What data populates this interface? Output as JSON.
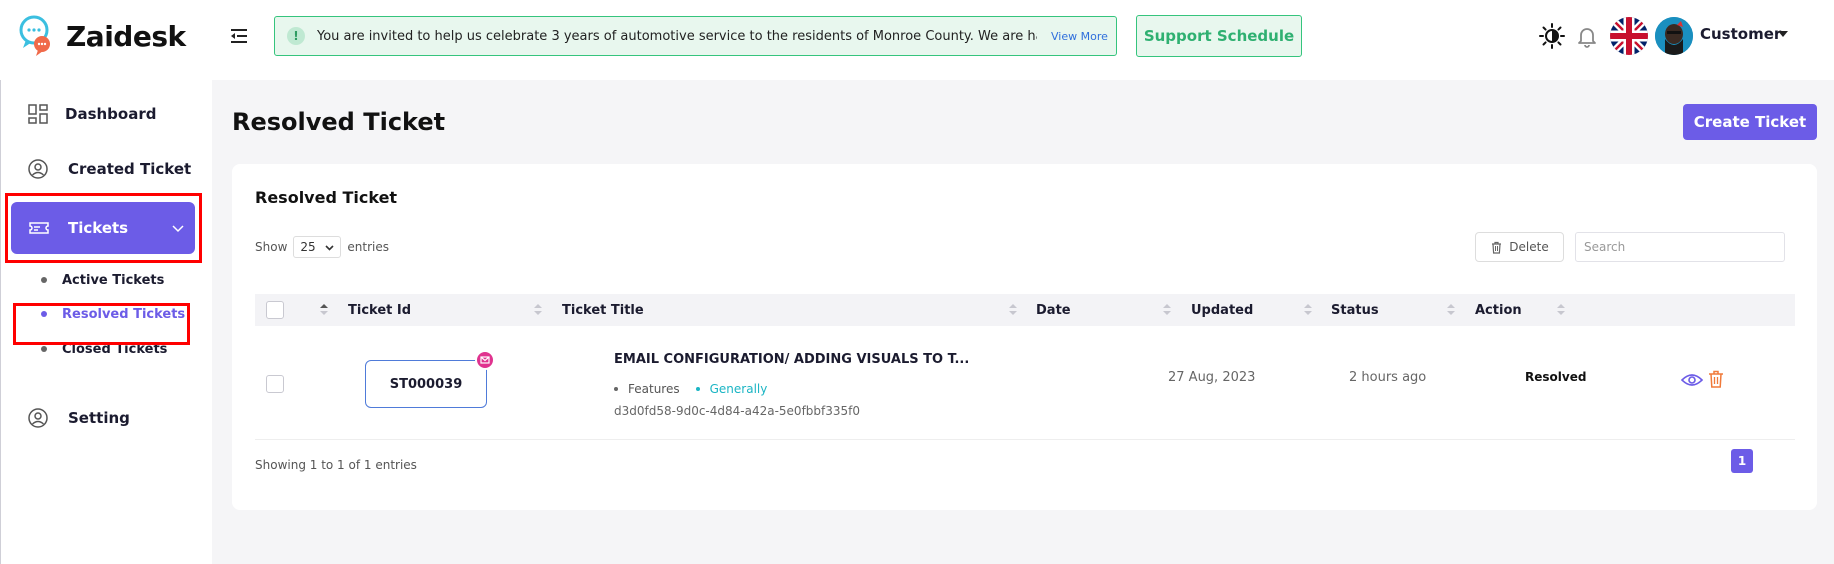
{
  "brand": {
    "name": "Zaidesk"
  },
  "header": {
    "notice_text": "You are invited to help us celebrate 3 years of automotive service to the residents of Monroe County. We are happy to be",
    "notice_link": "View More",
    "support_button": "Support Schedule",
    "user_name": "Customer",
    "icons": [
      "menu-toggle-icon",
      "theme-toggle-icon",
      "bell-icon",
      "uk-flag-icon",
      "avatar"
    ]
  },
  "sidebar": {
    "items": [
      {
        "label": "Dashboard",
        "icon": "dashboard-icon"
      },
      {
        "label": "Created Ticket",
        "icon": "user-circle-icon"
      },
      {
        "label": "Tickets",
        "icon": "ticket-icon",
        "active": true
      },
      {
        "label": "Setting",
        "icon": "user-circle-icon"
      }
    ],
    "sub_items": [
      {
        "label": "Active Tickets"
      },
      {
        "label": "Resolved Tickets",
        "current": true
      },
      {
        "label": "Closed Tickets"
      }
    ]
  },
  "page": {
    "title": "Resolved Ticket",
    "create_button": "Create Ticket"
  },
  "card": {
    "title": "Resolved Ticket",
    "show_label": "Show",
    "entries_value": "25",
    "entries_label": "entries",
    "delete_button": "Delete",
    "search_placeholder": "Search",
    "columns": [
      "Ticket Id",
      "Ticket Title",
      "Date",
      "Updated",
      "Status",
      "Action"
    ],
    "rows": [
      {
        "ticket_id": "ST000039",
        "title": "EMAIL CONFIGURATION/ ADDING VISUALS TO T...",
        "tag1": "Features",
        "tag2": "Generally",
        "uuid": "d3d0fd58-9d0c-4d84-a42a-5e0fbbf335f0",
        "date": "27 Aug, 2023",
        "updated": "2 hours ago",
        "status": "Resolved"
      }
    ],
    "showing_text": "Showing 1 to 1 of 1 entries",
    "current_page": "1"
  },
  "colors": {
    "accent": "#6c5ce7",
    "notice_border": "#35c47d",
    "tag_generally": "#1bb5c4",
    "mail_badge": "#e0338f",
    "delete_icon": "#f07a3a",
    "view_icon": "#6c5ce7",
    "highlight_box": "#ff0000"
  }
}
